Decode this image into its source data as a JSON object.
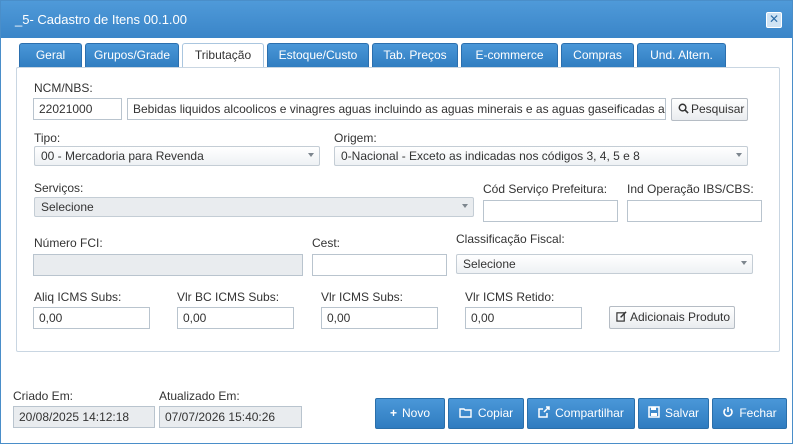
{
  "window": {
    "title": "_5- Cadastro de Itens 00.1.00",
    "close_glyph": "✕"
  },
  "tabs": [
    {
      "label": "Geral",
      "active": false
    },
    {
      "label": "Grupos/Grade",
      "active": false
    },
    {
      "label": "Tributação",
      "active": true
    },
    {
      "label": "Estoque/Custo",
      "active": false
    },
    {
      "label": "Tab. Preços",
      "active": false
    },
    {
      "label": "E-commerce",
      "active": false
    },
    {
      "label": "Compras",
      "active": false
    },
    {
      "label": "Und. Altern.",
      "active": false
    }
  ],
  "form": {
    "ncm_label": "NCM/NBS:",
    "ncm_code": "22021000",
    "ncm_description": "Bebidas liquidos alcoolicos e vinagres aguas incluindo as aguas minerais e as aguas gaseificadas adicionadas",
    "search_label": "Pesquisar",
    "tipo_label": "Tipo:",
    "tipo_value": "00 - Mercadoria para Revenda",
    "origem_label": "Origem:",
    "origem_value": "0-Nacional - Exceto as indicadas nos códigos 3, 4, 5 e 8",
    "servicos_label": "Serviços:",
    "servicos_value": "Selecione",
    "cod_servico_label": "Cód Serviço Prefeitura:",
    "cod_servico_value": "",
    "ind_operacao_label": "Ind Operação IBS/CBS:",
    "ind_operacao_value": "",
    "numero_fci_label": "Número FCI:",
    "numero_fci_value": "",
    "cest_label": "Cest:",
    "cest_value": "",
    "classificacao_label": "Classificação Fiscal:",
    "classificacao_value": "Selecione",
    "aliq_icms_subs_label": "Aliq ICMS Subs:",
    "aliq_icms_subs_value": "0,00",
    "vlr_bc_icms_subs_label": "Vlr BC ICMS Subs:",
    "vlr_bc_icms_subs_value": "0,00",
    "vlr_icms_subs_label": "Vlr ICMS Subs:",
    "vlr_icms_subs_value": "0,00",
    "vlr_icms_retido_label": "Vlr ICMS Retido:",
    "vlr_icms_retido_value": "0,00",
    "adicionais_label": "Adicionais Produto"
  },
  "footer": {
    "criado_label": "Criado Em:",
    "criado_value": "20/08/2025 14:12:18",
    "atualizado_label": "Atualizado Em:",
    "atualizado_value": "07/07/2026 15:40:26",
    "buttons": {
      "novo": "Novo",
      "copiar": "Copiar",
      "compartilhar": "Compartilhar",
      "salvar": "Salvar",
      "fechar": "Fechar"
    }
  },
  "colors": {
    "accent": "#3a85c8",
    "tab_blue": "#2f7cc0"
  },
  "icons": [
    "close-icon",
    "search-icon",
    "edit-icon",
    "plus-icon",
    "folder-icon",
    "share-icon",
    "save-icon",
    "power-icon"
  ]
}
